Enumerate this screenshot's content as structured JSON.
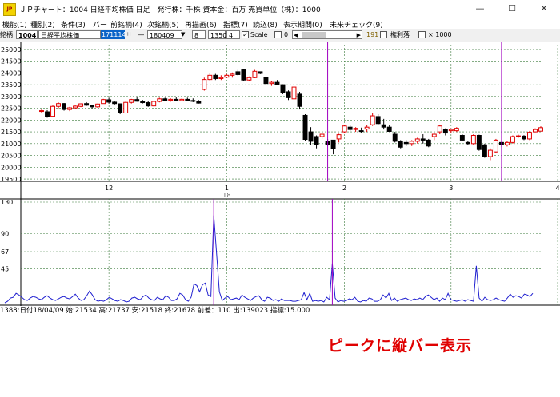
{
  "window": {
    "title": "ＪＰチャート：1004 日経平均株価 日足　発行株：千株 資本金：百万 売買単位（株）：1000",
    "app_icon_text": "JP",
    "controls": {
      "minimize": "—",
      "maximize": "☐",
      "close": "✕"
    }
  },
  "menu": [
    "機能(1)",
    "種別(2)",
    "条件(3)",
    "バー",
    "前銘柄(4)",
    "次銘柄(5)",
    "再描画(6)",
    "指標(7)",
    "読込(8)",
    "表示期間(0)",
    "未来チェック(9)"
  ],
  "toolbar": {
    "label": "銘柄",
    "code": "1004",
    "name": "日経平均株価",
    "start_date": "171114",
    "sep": "―",
    "end_date": "180409",
    "val_a": "8",
    "val_b": "1350",
    "val_c": "4",
    "scale_label": "Scale",
    "scale_checked": true,
    "zero_value": "0",
    "count": "191",
    "rights_label": "権利落",
    "x1000_label": "× 1000"
  },
  "chart_data": [
    {
      "type": "candlestick",
      "y_ticks": [
        25000,
        24500,
        24000,
        23500,
        23000,
        22500,
        22000,
        21500,
        21000,
        20500,
        20000,
        19500
      ],
      "ylim": [
        19400,
        25200
      ],
      "x_month_labels": [
        "12",
        "1",
        "2",
        "3",
        "4"
      ],
      "x_year_label": "18",
      "grid": true,
      "colors": {
        "up": "#e00000",
        "down": "#000000",
        "peak_line": "#a000c0",
        "grid": "#3a7a3a"
      },
      "candles": [
        [
          22380,
          22460,
          22310,
          22400
        ],
        [
          22350,
          22420,
          22100,
          22150
        ],
        [
          22160,
          22620,
          22120,
          22580
        ],
        [
          22580,
          22750,
          22500,
          22700
        ],
        [
          22700,
          22720,
          22400,
          22450
        ],
        [
          22450,
          22560,
          22380,
          22520
        ],
        [
          22520,
          22620,
          22480,
          22590
        ],
        [
          22580,
          22710,
          22550,
          22690
        ],
        [
          22700,
          22760,
          22600,
          22630
        ],
        [
          22620,
          22650,
          22500,
          22560
        ],
        [
          22560,
          22700,
          22520,
          22680
        ],
        [
          22700,
          22900,
          22690,
          22870
        ],
        [
          22860,
          22950,
          22700,
          22760
        ],
        [
          22760,
          22820,
          22650,
          22700
        ],
        [
          22690,
          22700,
          22250,
          22300
        ],
        [
          22300,
          22780,
          22280,
          22750
        ],
        [
          22750,
          22900,
          22700,
          22870
        ],
        [
          22870,
          22960,
          22780,
          22800
        ],
        [
          22800,
          22860,
          22700,
          22740
        ],
        [
          22740,
          22800,
          22560,
          22600
        ],
        [
          22600,
          22810,
          22580,
          22790
        ],
        [
          22790,
          22950,
          22750,
          22900
        ],
        [
          22900,
          22950,
          22800,
          22840
        ],
        [
          22840,
          22920,
          22780,
          22880
        ],
        [
          22880,
          22960,
          22800,
          22830
        ],
        [
          22830,
          22920,
          22800,
          22880
        ],
        [
          22880,
          22950,
          22800,
          22830
        ],
        [
          22830,
          22920,
          22760,
          22800
        ],
        [
          22800,
          22850,
          22700,
          22720
        ],
        [
          23300,
          23800,
          23250,
          23720
        ],
        [
          23720,
          23980,
          23650,
          23900
        ],
        [
          23900,
          23960,
          23700,
          23760
        ],
        [
          23760,
          23900,
          23700,
          23800
        ],
        [
          23820,
          23950,
          23780,
          23900
        ],
        [
          23900,
          24020,
          23800,
          23950
        ],
        [
          24050,
          24130,
          23880,
          23930
        ],
        [
          24130,
          24160,
          23650,
          23700
        ],
        [
          23700,
          23850,
          23650,
          23800
        ],
        [
          23800,
          24130,
          23780,
          24070
        ],
        [
          24050,
          24060,
          23950,
          23980
        ],
        [
          23800,
          23820,
          23500,
          23550
        ],
        [
          23550,
          23650,
          23450,
          23600
        ],
        [
          23600,
          23700,
          23480,
          23520
        ],
        [
          23500,
          23520,
          23100,
          23150
        ],
        [
          23200,
          23260,
          22850,
          22950
        ],
        [
          22900,
          23100,
          22850,
          23400
        ],
        [
          23100,
          23200,
          22450,
          22580
        ],
        [
          22200,
          22250,
          21100,
          21180
        ],
        [
          21500,
          21700,
          20950,
          21100
        ],
        [
          21300,
          21350,
          20800,
          20950
        ],
        [
          21300,
          21450,
          21200,
          21400
        ],
        [
          21100,
          21200,
          20900,
          20950
        ],
        [
          21150,
          21150,
          20550,
          20800
        ],
        [
          21200,
          21420,
          21050,
          21380
        ],
        [
          21500,
          21800,
          21450,
          21750
        ],
        [
          21700,
          21800,
          21530,
          21600
        ],
        [
          21600,
          21700,
          21500,
          21650
        ],
        [
          21550,
          21680,
          21450,
          21520
        ],
        [
          21620,
          21780,
          21500,
          21700
        ],
        [
          21800,
          22300,
          21750,
          22180
        ],
        [
          22150,
          22250,
          21800,
          21850
        ],
        [
          21800,
          22050,
          21600,
          21700
        ],
        [
          21700,
          21800,
          21500,
          21520
        ],
        [
          21400,
          21500,
          21050,
          21100
        ],
        [
          21100,
          21150,
          20800,
          20850
        ],
        [
          21050,
          21150,
          20900,
          21000
        ],
        [
          21000,
          21150,
          20900,
          21100
        ],
        [
          21100,
          21250,
          21000,
          21200
        ],
        [
          21200,
          21400,
          21000,
          21150
        ],
        [
          21150,
          21200,
          20850,
          20900
        ],
        [
          21300,
          21450,
          21150,
          21400
        ],
        [
          21500,
          21800,
          21400,
          21750
        ],
        [
          21600,
          21650,
          21350,
          21450
        ],
        [
          21550,
          21650,
          21450,
          21600
        ],
        [
          21550,
          21700,
          21500,
          21650
        ],
        [
          21350,
          21400,
          21100,
          21150
        ],
        [
          21050,
          21100,
          20950,
          21000
        ],
        [
          21000,
          21400,
          20950,
          21350
        ],
        [
          21350,
          21380,
          20700,
          20750
        ],
        [
          20950,
          21000,
          20400,
          20450
        ],
        [
          20450,
          20800,
          20300,
          20720
        ],
        [
          20650,
          21200,
          20620,
          21150
        ],
        [
          21050,
          21100,
          20850,
          20950
        ],
        [
          20950,
          21100,
          20880,
          21050
        ],
        [
          21050,
          21350,
          21000,
          21300
        ],
        [
          21300,
          21380,
          21250,
          21330
        ],
        [
          21320,
          21360,
          21150,
          21200
        ],
        [
          21200,
          21540,
          21150,
          21480
        ],
        [
          21500,
          21650,
          21480,
          21600
        ],
        [
          21530,
          21737,
          21518,
          21678
        ]
      ],
      "peak_indices": [
        51,
        82
      ]
    },
    {
      "type": "line",
      "y_ticks": [
        130,
        90,
        67,
        45
      ],
      "ylim": [
        0,
        130
      ],
      "series": [
        {
          "values": [
            2,
            4,
            8,
            9,
            14,
            12,
            9,
            6,
            5,
            8,
            10,
            9,
            7,
            6,
            9,
            11,
            8,
            6,
            5,
            7,
            9,
            10,
            8,
            7,
            10,
            13,
            8,
            5,
            6,
            11,
            17,
            12,
            6,
            4,
            5,
            4,
            6,
            9,
            7,
            5,
            4,
            6,
            5,
            3,
            4,
            8,
            9,
            7,
            6,
            10,
            12,
            8,
            6,
            5,
            9,
            7,
            6,
            11,
            9,
            5,
            5,
            7,
            14,
            12,
            6,
            4,
            9,
            26,
            24,
            16,
            25,
            27,
            12,
            10,
            113,
            65,
            16,
            5,
            8,
            10,
            6,
            7,
            8,
            6,
            12,
            9,
            7,
            5,
            8,
            10,
            11,
            6,
            4,
            9,
            8,
            5,
            6,
            4,
            7,
            5,
            5,
            5,
            4,
            4,
            5,
            6,
            15,
            6,
            14,
            4,
            5,
            4,
            5,
            3,
            9,
            6,
            52,
            8,
            3,
            5,
            4,
            5,
            7,
            6,
            9,
            4,
            3,
            5,
            4,
            8,
            7,
            4,
            4,
            6,
            12,
            8,
            14,
            5,
            8,
            4,
            6,
            7,
            8,
            6,
            5,
            7,
            6,
            8,
            6,
            10,
            12,
            9,
            6,
            8,
            4,
            8,
            6,
            14,
            6,
            5,
            4,
            5,
            6,
            4,
            6,
            5,
            4,
            49,
            8,
            4,
            9,
            6,
            5,
            6,
            8,
            6,
            5,
            4,
            8,
            13,
            9,
            11,
            10,
            8,
            13,
            12,
            10,
            14
          ]
        }
      ],
      "peak_indices": [
        74,
        116
      ]
    }
  ],
  "status": "1388:日付18/04/09 始:21534 高:21737 安:21518 終:21678 前差：110 出:139023 指標:15.000",
  "annotation": "ピークに縦バー表示"
}
